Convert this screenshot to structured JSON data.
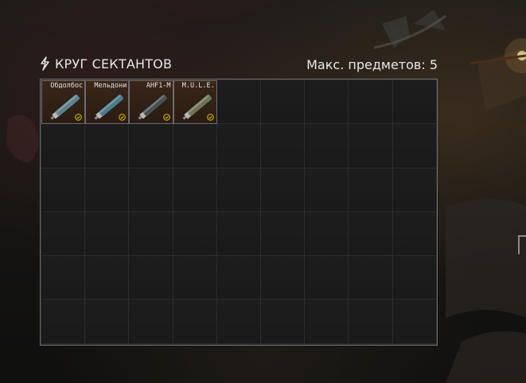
{
  "stash": {
    "title": "КРУГ СЕКТАНТОВ",
    "icon": "sect-symbol-icon",
    "capacity_label": "Макс. предметов: 5",
    "columns": 9,
    "rows": 6
  },
  "items": [
    {
      "name": "Обдолбос",
      "icon": "injector-icon",
      "color": "#5f7f8a"
    },
    {
      "name": "Мельдони",
      "icon": "injector-icon",
      "color": "#4d7a88"
    },
    {
      "name": "AHF1-M",
      "icon": "injector-icon",
      "color": "#4a4f4f"
    },
    {
      "name": "M.U.L.E.",
      "icon": "injector-icon",
      "color": "#6e7452"
    }
  ],
  "colors": {
    "accent": "#c8b400",
    "filled_cell": "#2f2016",
    "grid_border": "#6f6f6f"
  }
}
